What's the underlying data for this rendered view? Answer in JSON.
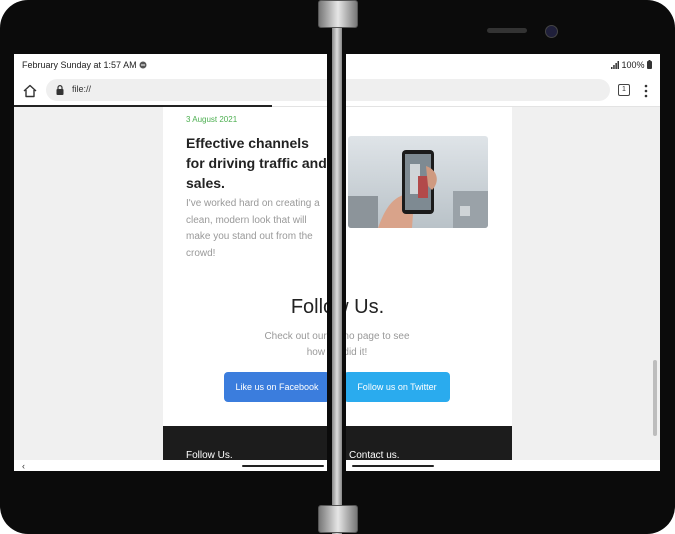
{
  "status_bar": {
    "left_text": "February Sunday at 1:57 AM",
    "battery": "100%"
  },
  "browser": {
    "url": "file://",
    "tab_count": "1"
  },
  "post": {
    "date": "3 August 2021",
    "title": "Effective channels for driving traffic and sales.",
    "text": "I've worked hard on creating a clean, modern look that will make you stand out from the crowd!"
  },
  "follow": {
    "title": "Follow Us.",
    "text": "Check out our demo page to see how we did it!",
    "facebook_button": "Like us on Facebook",
    "twitter_button": "Follow us on Twitter"
  },
  "footer": {
    "left_heading": "Follow Us.",
    "right_heading": "Contact us."
  },
  "colors": {
    "date_green": "#4caf50",
    "facebook_blue": "#3b7ddd",
    "twitter_blue": "#2aabee",
    "footer_dark": "#1c1c1c"
  },
  "icons": [
    "home-icon",
    "lock-icon",
    "tabs-icon",
    "menu-icon",
    "back-icon",
    "signal-icon",
    "battery-icon",
    "notification-icon"
  ]
}
